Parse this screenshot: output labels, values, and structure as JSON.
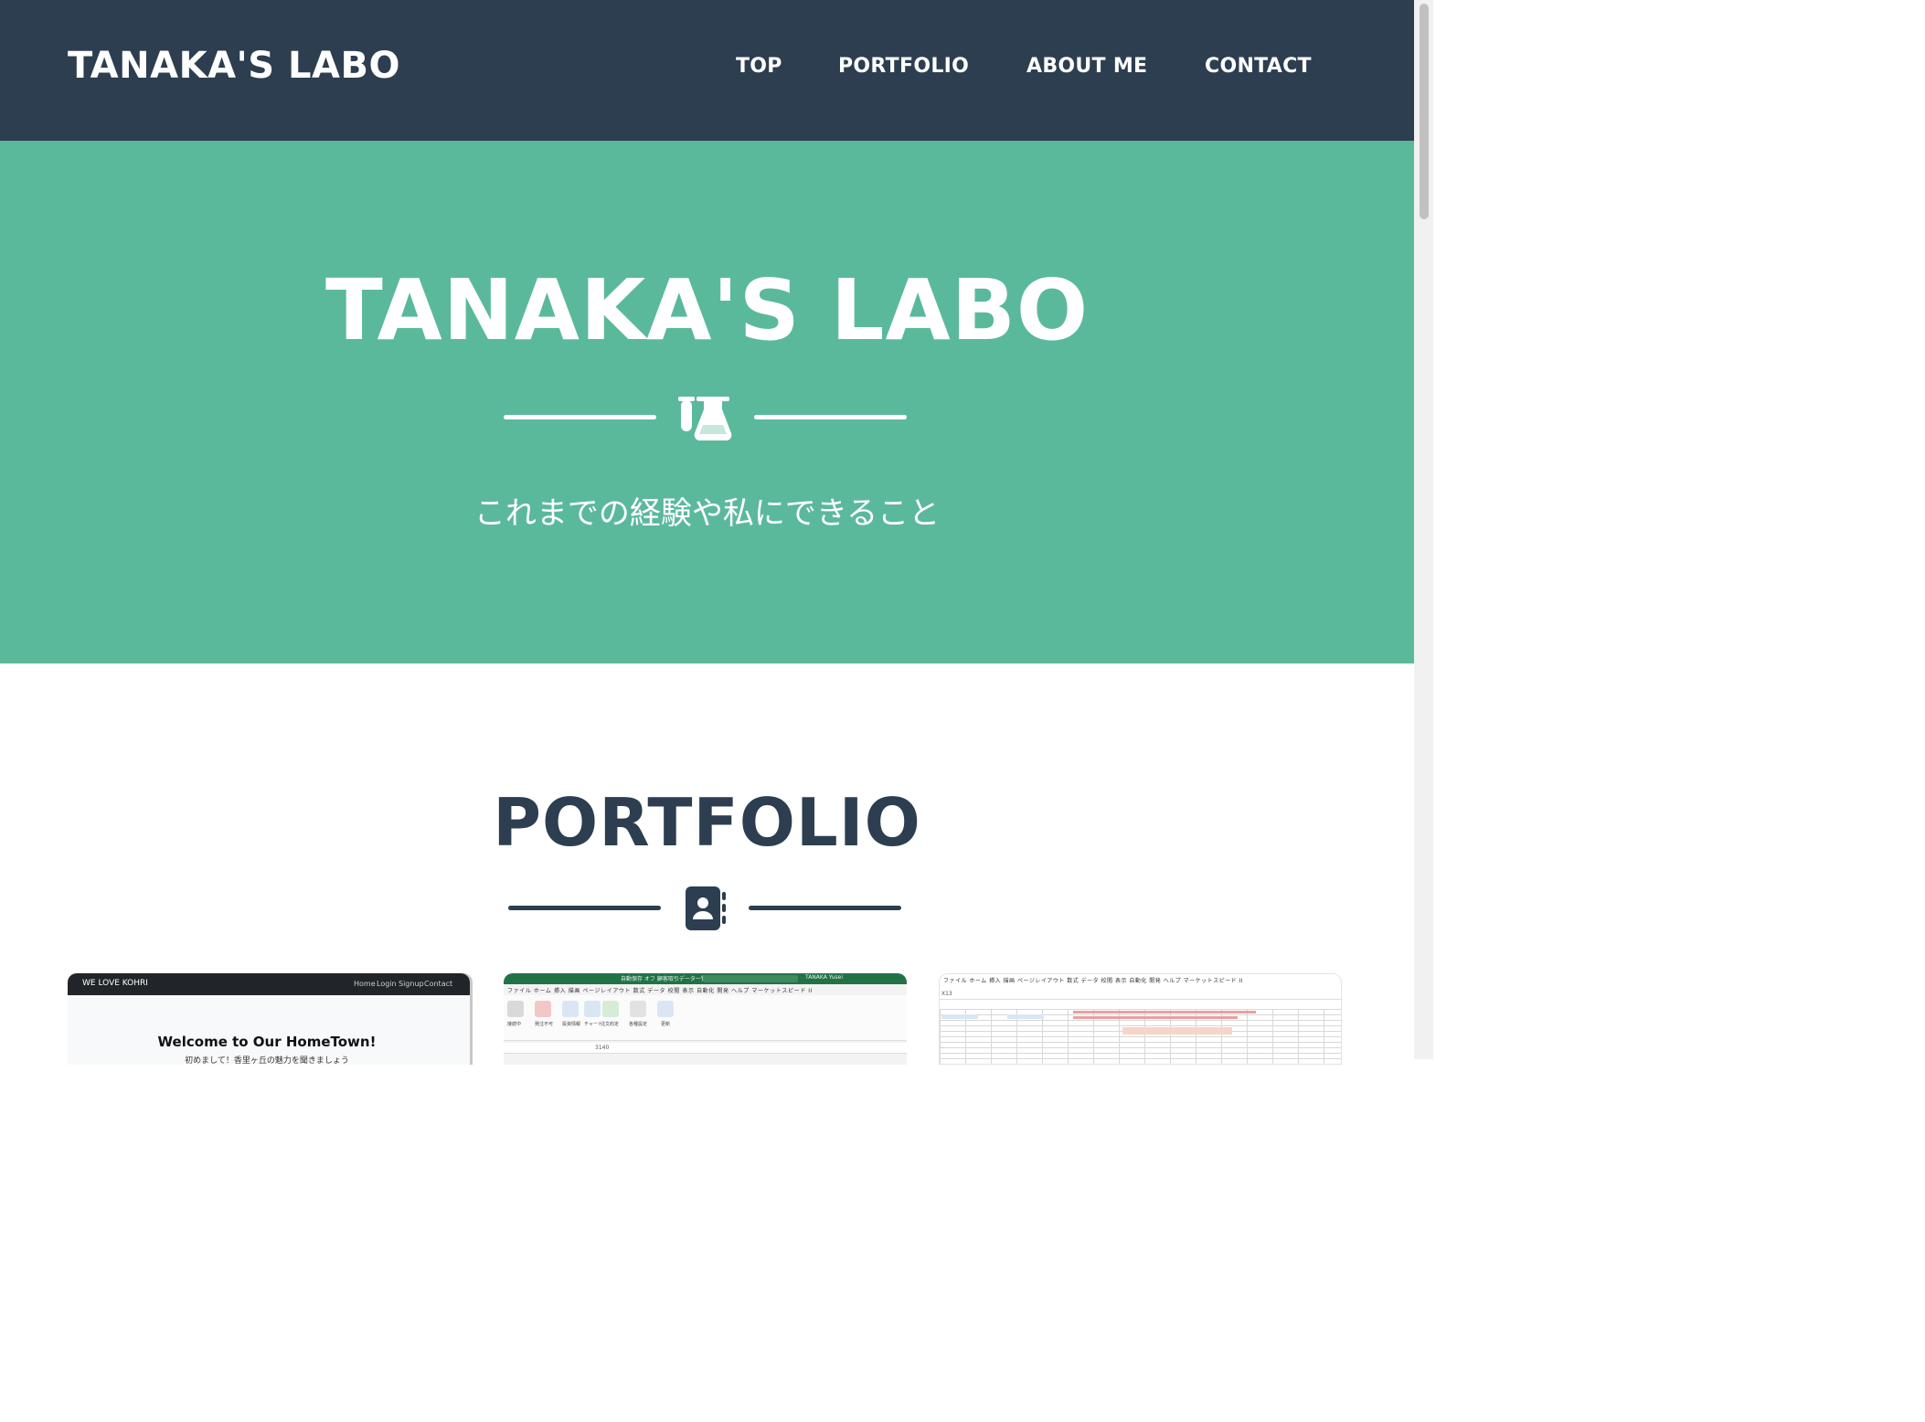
{
  "nav": {
    "brand": "TANAKA'S LABO",
    "links": [
      "TOP",
      "PORTFOLIO",
      "ABOUT ME",
      "CONTACT"
    ]
  },
  "hero": {
    "title": "TANAKA'S LABO",
    "icon": "flask-icon",
    "subtitle": "これまでの経験や私にできること"
  },
  "portfolio": {
    "title": "PORTFOLIO",
    "icon": "address-book-icon",
    "cards": [
      {
        "brand": "WE LOVE KOHRI",
        "menu": [
          "Home",
          "Login",
          "Signup",
          "Contact"
        ],
        "heading": "Welcome to Our HomeTown!",
        "sub": "初めまして！香里ヶ丘の魅力を聞きましょう"
      },
      {
        "titlebar": "自動保存 オフ  顧客取引データ一覧 | version",
        "user": "TANAKA Yusei",
        "tabs": "ファイル  ホーム  挿入  描画  ページレイアウト  数式  データ  校閲  表示  自動化  開発  ヘルプ  マーケットスピード II",
        "ribbon": [
          "接続中",
          "発注不可",
          "投資情報",
          "チャート",
          "注文約定",
          "各種設定",
          "更新"
        ],
        "cell_value": "3140"
      },
      {
        "menu": "ファイル  ホーム  挿入  描画  ページレイアウト  数式  データ  校閲  表示  自動化  開発  ヘルプ  マーケットスピード II",
        "cell_ref": "X13"
      }
    ]
  },
  "colors": {
    "navbar": "#2c3e50",
    "hero": "#5bb99b",
    "accent_text": "#2c3e50"
  }
}
